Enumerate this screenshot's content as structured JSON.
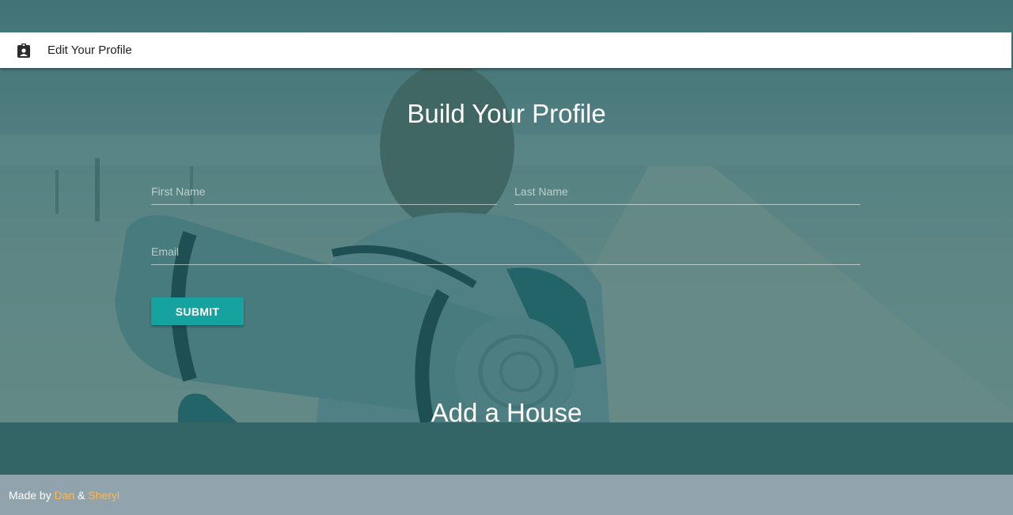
{
  "appbar": {
    "icon": "profile-badge-icon",
    "title": "Edit Your Profile"
  },
  "profile_form": {
    "title": "Build Your Profile",
    "first_name_placeholder": "First Name",
    "first_name_value": "",
    "last_name_placeholder": "Last Name",
    "last_name_value": "",
    "email_placeholder": "Email",
    "email_value": "",
    "submit_label": "SUBMIT"
  },
  "house_section": {
    "title": "Add a House"
  },
  "footer": {
    "prefix": "Made by ",
    "author1": "Dan",
    "separator": " & ",
    "author2": "Sheryl"
  },
  "colors": {
    "accent": "#16a3a0",
    "overlay": "#1e5c60",
    "band": "#336466",
    "footer_bg": "#91a4ad",
    "footer_link": "#ffb74d"
  }
}
